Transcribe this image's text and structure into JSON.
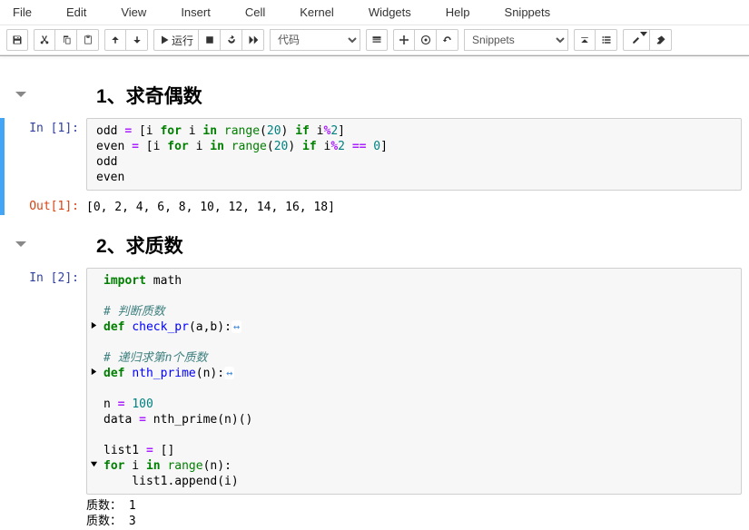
{
  "menubar": {
    "items": [
      "File",
      "Edit",
      "View",
      "Insert",
      "Cell",
      "Kernel",
      "Widgets",
      "Help",
      "Snippets"
    ]
  },
  "toolbar": {
    "run_label": "运行",
    "celltype_selected": "代码",
    "snippets_selected": "Snippets"
  },
  "cells": [
    {
      "type": "heading",
      "text": "1、求奇偶数"
    },
    {
      "type": "code",
      "selected": true,
      "prompt_in": "In  [1]:",
      "prompt_out": "Out[1]:",
      "output": "[0, 2, 4, 6, 8, 10, 12, 14, 16, 18]"
    },
    {
      "type": "heading",
      "text": "2、求质数"
    },
    {
      "type": "code",
      "selected": false,
      "prompt_in": "In  [2]:",
      "stream": "质数： 1\n质数： 3"
    }
  ],
  "code1": {
    "l1_a": "odd ",
    "l1_b": "=",
    "l1_c": " [i ",
    "l1_d": "for",
    "l1_e": " i ",
    "l1_f": "in",
    "l1_g": " ",
    "l1_h": "range",
    "l1_i": "(",
    "l1_j": "20",
    "l1_k": ") ",
    "l1_l": "if",
    "l1_m": " i",
    "l1_n": "%",
    "l1_o": "2",
    "l1_p": "]",
    "l2_a": "even ",
    "l2_b": "=",
    "l2_c": " [i ",
    "l2_d": "for",
    "l2_e": " i ",
    "l2_f": "in",
    "l2_g": " ",
    "l2_h": "range",
    "l2_i": "(",
    "l2_j": "20",
    "l2_k": ") ",
    "l2_l": "if",
    "l2_m": " i",
    "l2_n": "%",
    "l2_o": "2",
    "l2_p": " ",
    "l2_q": "==",
    "l2_r": " ",
    "l2_s": "0",
    "l2_t": "]",
    "l3": "odd",
    "l4": "even"
  },
  "code2": {
    "l1_a": "import",
    "l1_b": " math",
    "l3": "# 判断质数",
    "l4_a": "def",
    "l4_b": " ",
    "l4_c": "check_pr",
    "l4_d": "(a,b):",
    "l4_fold": "↔",
    "l6": "# 递归求第n个质数",
    "l7_a": "def",
    "l7_b": " ",
    "l7_c": "nth_prime",
    "l7_d": "(n):",
    "l7_fold": "↔",
    "l9_a": "n ",
    "l9_b": "=",
    "l9_c": " ",
    "l9_d": "100",
    "l10_a": "data ",
    "l10_b": "=",
    "l10_c": " nth_prime(n)()",
    "l12_a": "list1 ",
    "l12_b": "=",
    "l12_c": " []",
    "l13_a": "for",
    "l13_b": " i ",
    "l13_c": "in",
    "l13_d": " ",
    "l13_e": "range",
    "l13_f": "(n):",
    "l14": "    list1.append(i)"
  }
}
